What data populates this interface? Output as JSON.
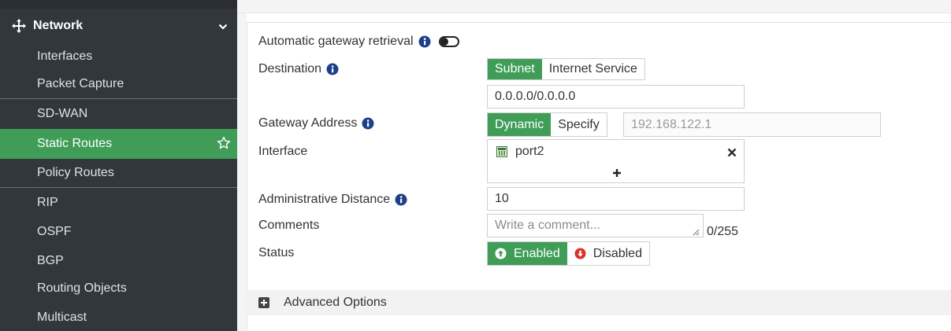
{
  "sidebar": {
    "section_label": "Network",
    "items": [
      {
        "label": "Interfaces"
      },
      {
        "label": "Packet Capture"
      },
      {
        "label": "SD-WAN"
      },
      {
        "label": "Static Routes"
      },
      {
        "label": "Policy Routes"
      },
      {
        "label": "RIP"
      },
      {
        "label": "OSPF"
      },
      {
        "label": "BGP"
      },
      {
        "label": "Routing Objects"
      },
      {
        "label": "Multicast"
      }
    ],
    "active_item": "Static Routes"
  },
  "form": {
    "auto_gateway": {
      "label": "Automatic gateway retrieval",
      "enabled": false
    },
    "destination": {
      "label": "Destination",
      "options": [
        "Subnet",
        "Internet Service"
      ],
      "selected": "Subnet",
      "value": "0.0.0.0/0.0.0.0"
    },
    "gateway": {
      "label": "Gateway Address",
      "options": [
        "Dynamic",
        "Specify"
      ],
      "selected": "Dynamic",
      "placeholder": "192.168.122.1"
    },
    "interface": {
      "label": "Interface",
      "value": "port2"
    },
    "admin_distance": {
      "label": "Administrative Distance",
      "value": "10"
    },
    "comments": {
      "label": "Comments",
      "placeholder": "Write a comment...",
      "counter": "0/255"
    },
    "status": {
      "label": "Status",
      "options": [
        "Enabled",
        "Disabled"
      ],
      "selected": "Enabled"
    }
  },
  "advanced": {
    "label": "Advanced Options"
  },
  "colors": {
    "accent": "#3f9d58",
    "sidebar_bg": "#32373c",
    "danger": "#d9322b"
  }
}
